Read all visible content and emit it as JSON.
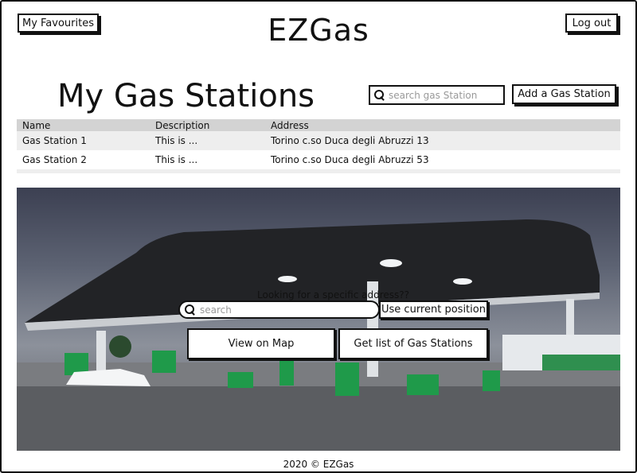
{
  "header": {
    "favourites_label": "My Favourites",
    "brand": "EZGas",
    "logout_label": "Log out"
  },
  "page": {
    "title": "My Gas Stations",
    "search_placeholder": "search gas Station",
    "add_label": "Add a Gas Station"
  },
  "table": {
    "columns": [
      "Name",
      "Description",
      "Address"
    ],
    "rows": [
      [
        "Gas Station 1",
        "This is ...",
        "Torino c.so Duca degli Abruzzi 13"
      ],
      [
        "Gas Station 2",
        "This is ...",
        "Torino c.so Duca degli Abruzzi 53"
      ]
    ]
  },
  "hero": {
    "label": "Looking for a specific address??",
    "search_placeholder": "search",
    "current_position_label": "Use current position",
    "view_map_label": "View on Map",
    "list_label": "Get list of Gas Stations"
  },
  "footer": {
    "text": "2020 © EZGas"
  },
  "icons": {
    "search": "search-icon"
  }
}
